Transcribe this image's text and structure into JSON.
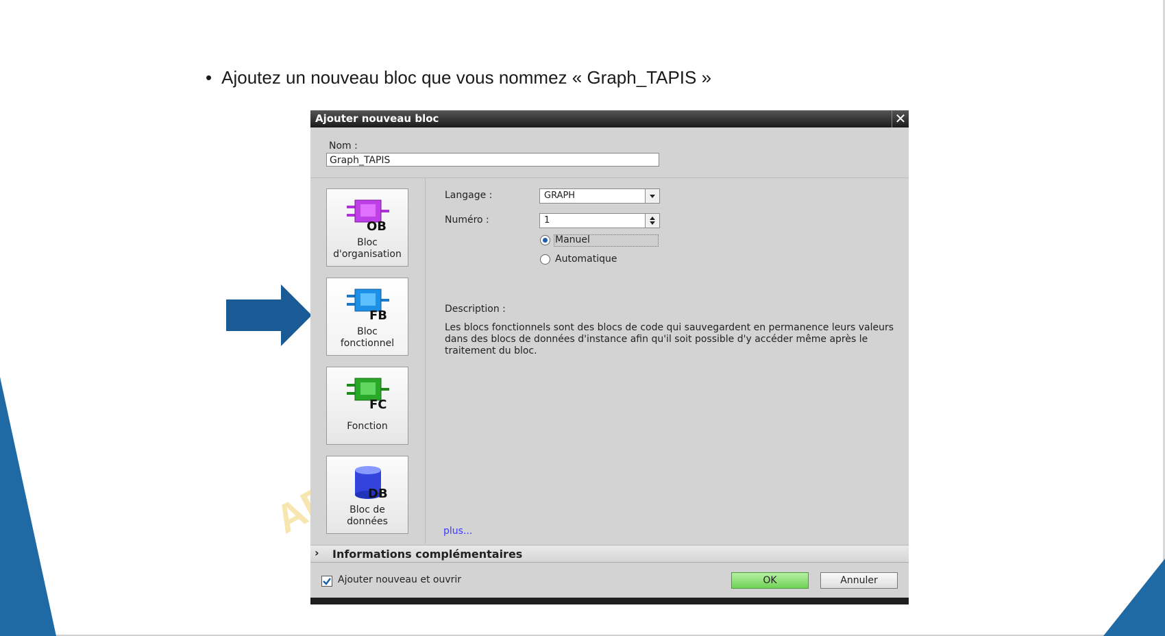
{
  "slide": {
    "bullet_text": "Ajoutez un nouveau bloc que vous nommez « Graph_TAPIS »",
    "watermark_text": "AP",
    "accent_color": "#1f6aa5"
  },
  "dialog": {
    "title": "Ajouter nouveau bloc",
    "close_icon": "close-icon",
    "nom_label": "Nom :",
    "nom_value": "Graph_TAPIS",
    "block_types": [
      {
        "label_line1": "Bloc",
        "label_line2": "d'organisation",
        "badge": "OB",
        "icon": "ob-block-icon",
        "color": "#b030d8"
      },
      {
        "label_line1": "Bloc",
        "label_line2": "fonctionnel",
        "badge": "FB",
        "icon": "fb-block-icon",
        "color": "#1e90e6"
      },
      {
        "label_line1": "Fonction",
        "label_line2": "",
        "badge": "FC",
        "icon": "fc-block-icon",
        "color": "#2aa82a"
      },
      {
        "label_line1": "Bloc de",
        "label_line2": "données",
        "badge": "DB",
        "icon": "db-block-icon",
        "color": "#3344dd"
      }
    ],
    "selected_block": "Bloc fonctionnel",
    "langage_label": "Langage :",
    "langage_value": "GRAPH",
    "numero_label": "Numéro :",
    "numero_value": "1",
    "radio_manuel": "Manuel",
    "radio_automatique": "Automatique",
    "radio_selected": "Manuel",
    "description_label": "Description :",
    "description_text": "Les blocs fonctionnels sont des blocs de code qui sauvegardent en permanence leurs valeurs dans des blocs de données d'instance afin qu'il soit possible d'y accéder même après le traitement du bloc.",
    "plus_link": "plus...",
    "info_section": "Informations complémentaires",
    "checkbox_label": "Ajouter nouveau et ouvrir",
    "checkbox_checked": true,
    "ok_label": "OK",
    "cancel_label": "Annuler"
  }
}
